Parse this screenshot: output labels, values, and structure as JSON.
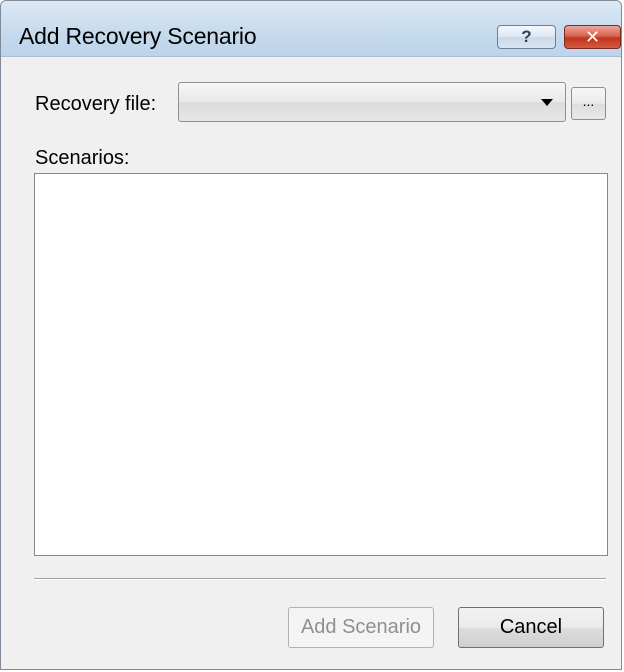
{
  "window": {
    "title": "Add Recovery Scenario",
    "help_glyph": "?",
    "close_glyph": "✕"
  },
  "form": {
    "recovery_file_label": "Recovery file:",
    "recovery_file_value": "",
    "browse_label": "...",
    "scenarios_label": "Scenarios:",
    "scenarios_items": []
  },
  "buttons": {
    "add_scenario": "Add Scenario",
    "add_scenario_enabled": false,
    "cancel": "Cancel"
  }
}
